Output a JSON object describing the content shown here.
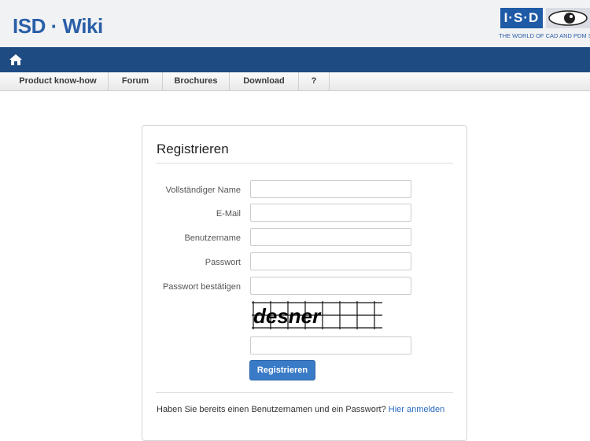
{
  "header": {
    "site_title": "ISD · Wiki",
    "logo_text": "I·S·D",
    "logo_tagline": "THE WORLD OF CAD AND PDM SOLUTIONS"
  },
  "menu": {
    "items": [
      {
        "label": "Product know-how"
      },
      {
        "label": "Forum"
      },
      {
        "label": "Brochures"
      },
      {
        "label": "Download"
      },
      {
        "label": "?"
      }
    ]
  },
  "form": {
    "title": "Registrieren",
    "fields": [
      {
        "label": "Vollständiger Name",
        "value": ""
      },
      {
        "label": "E-Mail",
        "value": ""
      },
      {
        "label": "Benutzername",
        "value": ""
      },
      {
        "label": "Passwort",
        "value": ""
      },
      {
        "label": "Passwort bestätigen",
        "value": ""
      }
    ],
    "captcha_text": "desner",
    "captcha_value": "",
    "submit_label": "Registrieren",
    "footer_text": "Haben Sie bereits einen Benutzernamen und ein Passwort?",
    "footer_link": "Hier anmelden"
  },
  "colors": {
    "brand_blue": "#1e4b82",
    "title_blue": "#2a5fa8",
    "button_blue": "#3a7bc8"
  },
  "icons": {
    "home": "home-icon",
    "logo_eye": "eye-icon"
  }
}
